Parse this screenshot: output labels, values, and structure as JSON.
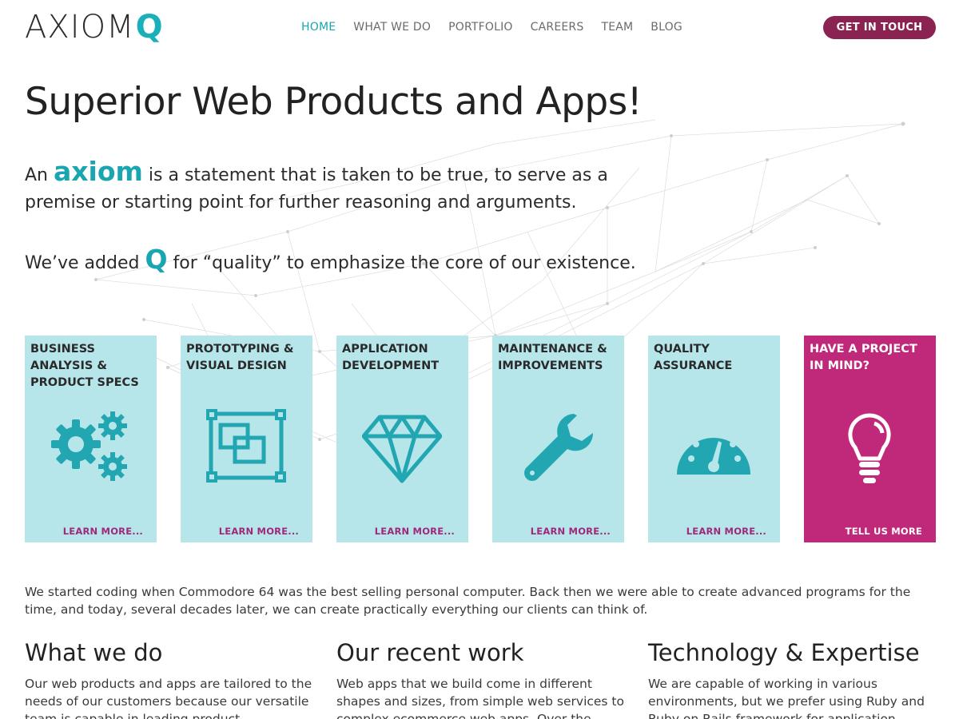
{
  "header": {
    "logo_main": "AXIOM",
    "logo_q": "Q",
    "nav": [
      {
        "label": "HOME",
        "active": true
      },
      {
        "label": "WHAT WE DO",
        "active": false
      },
      {
        "label": "PORTFOLIO",
        "active": false
      },
      {
        "label": "CAREERS",
        "active": false
      },
      {
        "label": "TEAM",
        "active": false
      },
      {
        "label": "BLOG",
        "active": false
      }
    ],
    "cta_label": "GET IN TOUCH"
  },
  "hero": {
    "title": "Superior Web Products and Apps!",
    "p1_prefix": "An ",
    "p1_highlight": "axiom",
    "p1_rest": " is a statement that is taken to be true, to serve as a premise or starting point for further reasoning and arguments.",
    "p2_prefix": "We’ve added ",
    "p2_highlight": "Q",
    "p2_rest": " for “quality” to emphasize the core of our existence."
  },
  "services": [
    {
      "title": "BUSINESS ANALYSIS & PRODUCT SPECS",
      "link": "LEARN MORE...",
      "icon": "gears-icon"
    },
    {
      "title": "PROTOTYPING & VISUAL DESIGN",
      "link": "LEARN MORE...",
      "icon": "layers-frame-icon"
    },
    {
      "title": "APPLICATION DEVELOPMENT",
      "link": "LEARN MORE...",
      "icon": "diamond-icon"
    },
    {
      "title": "MAINTENANCE & IMPROVEMENTS",
      "link": "LEARN MORE...",
      "icon": "wrench-icon"
    },
    {
      "title": "QUALITY ASSURANCE",
      "link": "LEARN MORE...",
      "icon": "gauge-icon"
    },
    {
      "title": "HAVE A PROJECT IN MIND?",
      "link": "TELL US MORE",
      "icon": "lightbulb-icon"
    }
  ],
  "intro": "We started coding when Commodore 64 was the best selling personal computer. Back then we were able to create advanced programs for the time, and today, several decades later, we can create practically everything our clients can think of.",
  "columns": [
    {
      "title": "What we do",
      "text": "Our web products and apps are tailored to the needs of our customers because our versatile team is capable in leading product development"
    },
    {
      "title": "Our recent work",
      "text": "Web apps that we build come in different shapes and sizes, from simple web services to complex ecommerce web apps. Over the years"
    },
    {
      "title": "Technology & Expertise",
      "text": "We are capable of working in various environments, but we prefer using Ruby and Ruby on Rails framework for application"
    }
  ],
  "colors": {
    "teal": "#1aa6b0",
    "card_bg": "#b6e6ea",
    "icon": "#22a7b2",
    "pink": "#c0287a",
    "cta": "#8a2352"
  }
}
